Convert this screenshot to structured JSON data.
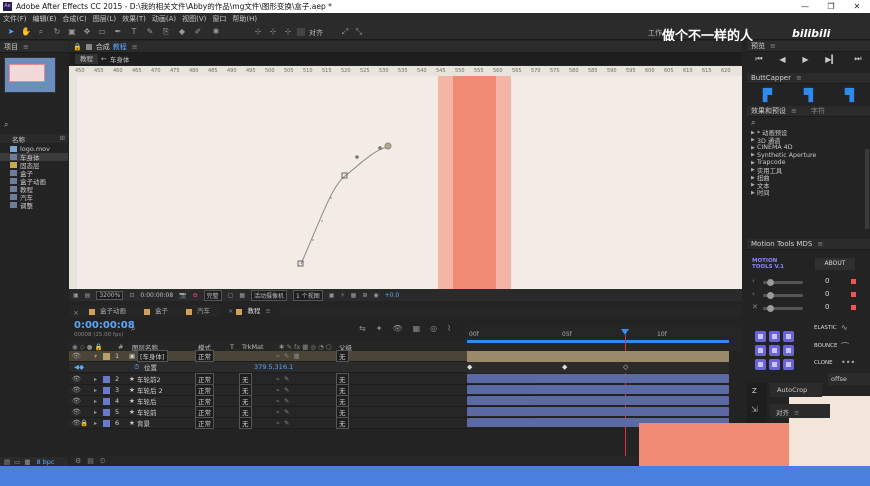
{
  "window": {
    "title": "Adobe After Effects CC 2015 - D:\\我的相关文件\\Abby的作品\\mg文件\\图形变换\\盒子.aep *",
    "watermark": "做个不一样的人",
    "watermark_logo": "bilibili",
    "workspace_partial": "工作"
  },
  "menu": [
    "文件(F)",
    "编辑(E)",
    "合成(C)",
    "图层(L)",
    "效果(T)",
    "动画(A)",
    "视图(V)",
    "窗口",
    "帮助(H)"
  ],
  "toolbar": {
    "snap_label": "对齐"
  },
  "project": {
    "title": "项目",
    "column_name": "名称",
    "items": [
      {
        "name": "logo.mov",
        "type": "footage"
      },
      {
        "name": "车身体",
        "type": "comp",
        "selected": true
      },
      {
        "name": "固态层",
        "type": "folder"
      },
      {
        "name": "盒子",
        "type": "comp"
      },
      {
        "name": "盒子动画",
        "type": "comp"
      },
      {
        "name": "教程",
        "type": "comp"
      },
      {
        "name": "汽车",
        "type": "comp"
      },
      {
        "name": "调整",
        "type": "comp"
      }
    ],
    "bpc": "8 bpc"
  },
  "comp": {
    "panel_label": "合成",
    "comp_name": "教程",
    "tab_active": "教程",
    "breadcrumb_child": "车身体",
    "ruler_ticks": [
      "450",
      "455",
      "460",
      "465",
      "470",
      "475",
      "480",
      "485",
      "490",
      "495",
      "500",
      "505",
      "510",
      "515",
      "520",
      "525",
      "530",
      "535",
      "540",
      "545",
      "550",
      "555",
      "560",
      "565",
      "570",
      "575",
      "580",
      "585",
      "590",
      "595",
      "600",
      "605",
      "610",
      "615",
      "620"
    ],
    "zoom": "3200%",
    "timecode": "0:00:00:08",
    "resolution": "完整",
    "camera": "活动摄像机",
    "views": "1 个视图",
    "exposure": "+0.0"
  },
  "timeline": {
    "tabs": [
      {
        "label": "盒子动画",
        "color": "#d7a05a"
      },
      {
        "label": "盒子",
        "color": "#d7a05a"
      },
      {
        "label": "汽车",
        "color": "#d7a05a"
      },
      {
        "label": "教程",
        "color": "#d7a05a",
        "active": true
      }
    ],
    "timecode": "0:00:00:08",
    "fps_note": "00008 (25.00 fps)",
    "headers": {
      "name": "图层名称",
      "mode": "模式",
      "t": "T",
      "trkmat": "TrkMat",
      "parent": "父级",
      "num": "#"
    },
    "ruler": {
      "start": "00f",
      "mid": "05f",
      "end": "10f"
    },
    "layers": [
      {
        "num": "1",
        "name": "[车身体]",
        "mode": "正常",
        "trkmat": "",
        "parent": "无",
        "label": "#b89f6a",
        "selected": true
      },
      {
        "prop": "位置",
        "value": "379.5,316.1"
      },
      {
        "num": "2",
        "name": "车轮前2",
        "mode": "正常",
        "trkmat": "无",
        "parent": "无",
        "label": "#6a79c8"
      },
      {
        "num": "3",
        "name": "车轮后 2",
        "mode": "正常",
        "trkmat": "无",
        "parent": "无",
        "label": "#6a79c8"
      },
      {
        "num": "4",
        "name": "车轮后",
        "mode": "正常",
        "trkmat": "无",
        "parent": "无",
        "label": "#6a79c8"
      },
      {
        "num": "5",
        "name": "车轮前",
        "mode": "正常",
        "trkmat": "无",
        "parent": "无",
        "label": "#6a79c8"
      },
      {
        "num": "6",
        "name": "背景",
        "mode": "正常",
        "trkmat": "无",
        "parent": "无",
        "label": "#6a79c8"
      }
    ]
  },
  "right": {
    "preview_title": "预览",
    "buttcapper_title": "ButtCapper",
    "effects_title": "效果和预设",
    "char_tab": "字符",
    "effects": [
      "* 动画预设",
      "3D 通道",
      "CINEMA 4D",
      "Synthetic Aperture",
      "Trapcode",
      "实用工具",
      "扭曲",
      "文本",
      "时间"
    ],
    "motion_tools_title": "Motion Tools MDS",
    "motion_tools_logo": [
      "MOTION",
      "TOOLS V.1"
    ],
    "about": "ABOUT",
    "slider_values": [
      "0",
      "0",
      "0"
    ],
    "buttons": {
      "elastic": "ELASTIC",
      "bounce": "BOUNCE",
      "clone": "CLONE"
    },
    "autocrop": "AutoCrop",
    "align_title": "对齐",
    "z_label": "Z",
    "offset_partial": "offse"
  },
  "colors": {
    "accent_blue": "#2d8ceb",
    "timecode_blue": "#5aa9ff",
    "brand_purple": "#6c63d9",
    "salmon": "#f08a72",
    "taskbar": "#4a7fdd"
  }
}
